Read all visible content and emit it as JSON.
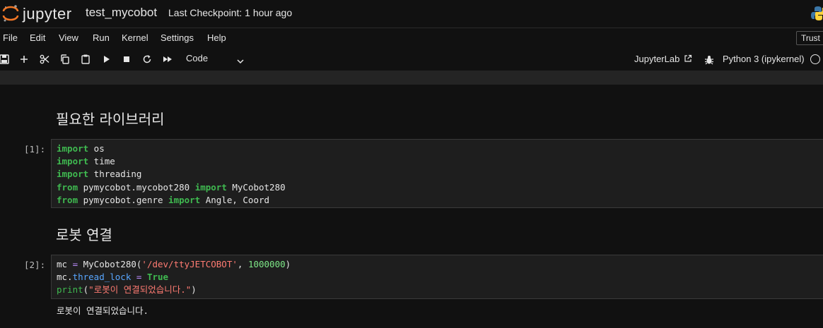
{
  "header": {
    "logo_text": "jupyter",
    "notebook_title": "test_mycobot",
    "checkpoint": "Last Checkpoint: 1 hour ago"
  },
  "menu": {
    "items": [
      "File",
      "Edit",
      "View",
      "Run",
      "Kernel",
      "Settings",
      "Help"
    ],
    "trust_label": "Trust"
  },
  "toolbar": {
    "cell_type": "Code",
    "jupyterlab_label": "JupyterLab",
    "kernel_name": "Python 3 (ipykernel)"
  },
  "cells": {
    "md1": {
      "text": "필요한 라이브러리"
    },
    "code1": {
      "prompt": "[1]:",
      "lines": [
        [
          {
            "t": "import",
            "c": "kw"
          },
          {
            "t": " os",
            "c": ""
          }
        ],
        [
          {
            "t": "import",
            "c": "kw"
          },
          {
            "t": " time",
            "c": ""
          }
        ],
        [
          {
            "t": "import",
            "c": "kw"
          },
          {
            "t": " threading",
            "c": ""
          }
        ],
        [
          {
            "t": "from",
            "c": "kw"
          },
          {
            "t": " pymycobot.mycobot280 ",
            "c": ""
          },
          {
            "t": "import",
            "c": "kw"
          },
          {
            "t": " MyCobot280",
            "c": ""
          }
        ],
        [
          {
            "t": "from",
            "c": "kw"
          },
          {
            "t": " pymycobot.genre ",
            "c": ""
          },
          {
            "t": "import",
            "c": "kw"
          },
          {
            "t": " Angle, Coord",
            "c": ""
          }
        ]
      ]
    },
    "md2": {
      "text": "로봇 연결"
    },
    "code2": {
      "prompt": "[2]:",
      "lines": [
        [
          {
            "t": "mc ",
            "c": ""
          },
          {
            "t": "=",
            "c": "op"
          },
          {
            "t": " MyCobot280(",
            "c": ""
          },
          {
            "t": "'/dev/ttyJETCOBOT'",
            "c": "str"
          },
          {
            "t": ", ",
            "c": ""
          },
          {
            "t": "1000000",
            "c": "num"
          },
          {
            "t": ")",
            "c": ""
          }
        ],
        [
          {
            "t": "mc.",
            "c": ""
          },
          {
            "t": "thread_lock",
            "c": "attr"
          },
          {
            "t": " ",
            "c": ""
          },
          {
            "t": "=",
            "c": "op"
          },
          {
            "t": " ",
            "c": ""
          },
          {
            "t": "True",
            "c": "kw"
          }
        ],
        [
          {
            "t": "print",
            "c": "builtin"
          },
          {
            "t": "(",
            "c": ""
          },
          {
            "t": "\"로봇이 연결되었습니다.\"",
            "c": "str"
          },
          {
            "t": ")",
            "c": ""
          }
        ]
      ],
      "output": "로봇이 연결되었습니다."
    }
  },
  "colors": {
    "background": "#111111",
    "keyword": "#3fb950",
    "string": "#ff7b72",
    "number": "#7ee787",
    "attribute": "#58a6ff"
  }
}
